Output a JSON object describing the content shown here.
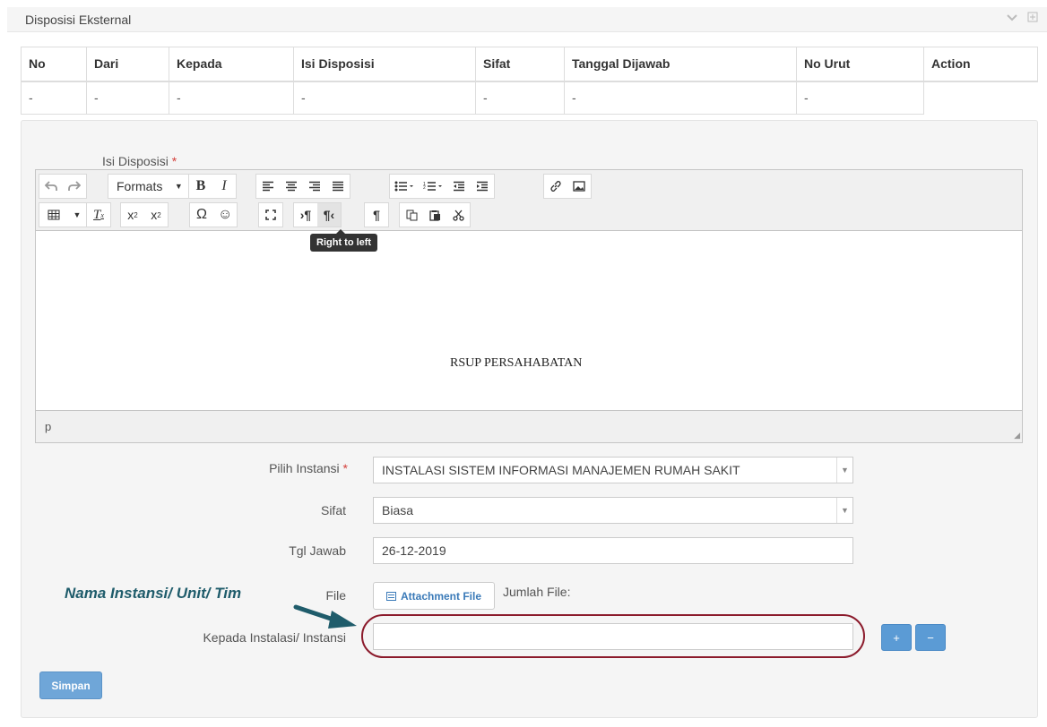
{
  "panel": {
    "title": "Disposisi Eksternal"
  },
  "table": {
    "columns": [
      "No",
      "Dari",
      "Kepada",
      "Isi Disposisi",
      "Sifat",
      "Tanggal Dijawab",
      "No Urut",
      "Action"
    ],
    "rows": [
      [
        "-",
        "-",
        "-",
        "-",
        "-",
        "-",
        "-",
        ""
      ]
    ]
  },
  "editor": {
    "label": "Isi Disposisi",
    "formats_label": "Formats",
    "tooltip": "Right to left",
    "content": "RSUP PERSAHABATAN",
    "status_path": "p",
    "toolbar_row1": [
      "undo-icon",
      "redo-icon",
      "formats-dropdown",
      "bold-icon",
      "italic-icon",
      "align-left-icon",
      "align-center-icon",
      "align-right-icon",
      "align-justify-icon",
      "bullet-list-icon",
      "numbered-list-icon",
      "outdent-icon",
      "indent-icon",
      "link-icon",
      "image-icon"
    ],
    "toolbar_row2": [
      "table-icon",
      "clear-format-icon",
      "subscript-icon",
      "superscript-icon",
      "special-char-icon",
      "emoticon-icon",
      "fullscreen-icon",
      "ltr-icon",
      "rtl-icon",
      "show-blocks-icon",
      "copy-icon",
      "paste-icon",
      "cut-icon"
    ]
  },
  "form": {
    "instansi_label": "Pilih Instansi",
    "instansi_value": "INSTALASI SISTEM INFORMASI MANAJEMEN RUMAH SAKIT",
    "sifat_label": "Sifat",
    "sifat_value": "Biasa",
    "tgl_label": "Tgl Jawab",
    "tgl_value": "26-12-2019",
    "file_label": "File",
    "attach_label": "Attachment File",
    "jumlah_label": "Jumlah File:",
    "kepada_label": "Kepada Instalasi/ Instansi",
    "kepada_value": "",
    "add_label": "+",
    "remove_label": "−",
    "save_label": "Simpan",
    "required_mark": "*"
  },
  "annotation": {
    "text": "Nama Instansi/ Unit/ Tim"
  },
  "colors": {
    "accent": "#5b9bd5",
    "annotation": "#1f5c6b",
    "highlight": "#8b1a2b",
    "required": "#d43f3a"
  }
}
